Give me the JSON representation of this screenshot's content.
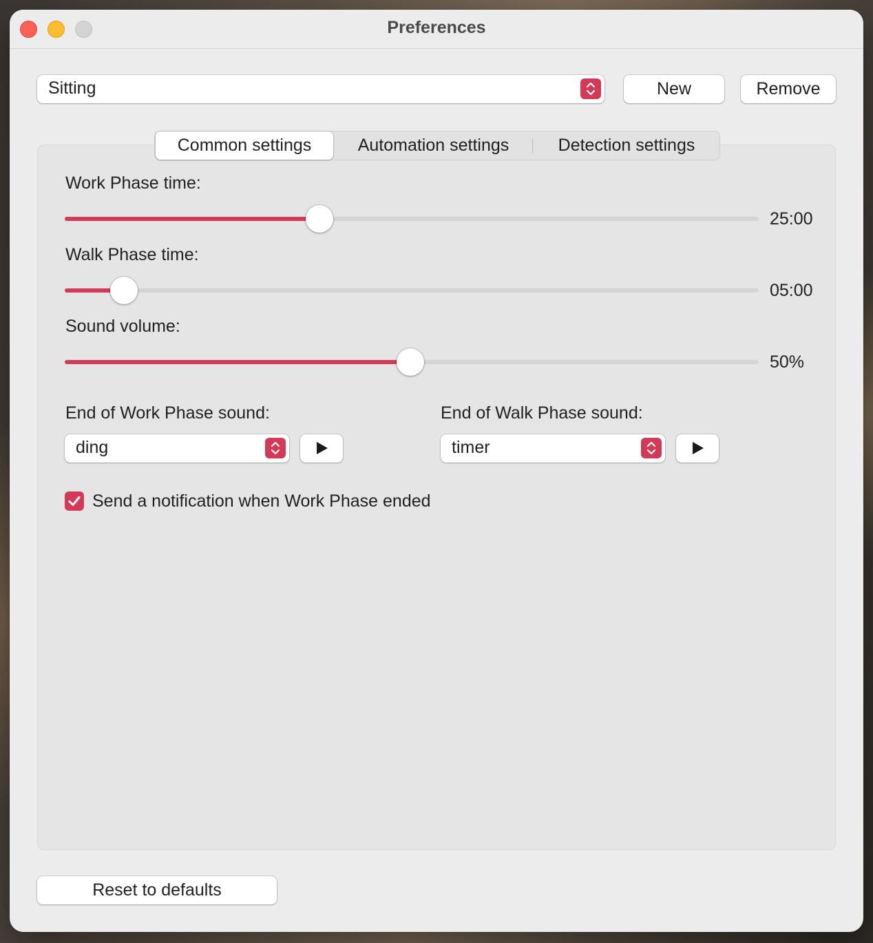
{
  "window": {
    "title": "Preferences"
  },
  "profile": {
    "selected": "Sitting",
    "new_label": "New",
    "remove_label": "Remove"
  },
  "tabs": [
    {
      "label": "Common settings",
      "active": true
    },
    {
      "label": "Automation settings",
      "active": false
    },
    {
      "label": "Detection settings",
      "active": false
    }
  ],
  "common": {
    "work_phase": {
      "label": "Work Phase time:",
      "value": "25:00",
      "fraction": 0.367
    },
    "walk_phase": {
      "label": "Walk Phase time:",
      "value": "05:00",
      "fraction": 0.085
    },
    "volume": {
      "label": "Sound volume:",
      "value": "50%",
      "fraction": 0.498
    },
    "work_sound": {
      "label": "End of Work Phase sound:",
      "selected": "ding"
    },
    "walk_sound": {
      "label": "End of Walk Phase sound:",
      "selected": "timer"
    },
    "notify": {
      "label": "Send a notification when Work Phase ended",
      "checked": true
    }
  },
  "footer": {
    "reset_label": "Reset to defaults"
  },
  "colors": {
    "accent": "#d33a57",
    "window_bg": "#ececec",
    "group_bg": "#e5e5e5"
  },
  "icons": {
    "close": "close-icon",
    "minimize": "minimize-icon",
    "zoom": "zoom-icon",
    "stepper": "up-down-chevron-icon",
    "play": "play-icon",
    "check": "checkmark-icon"
  }
}
